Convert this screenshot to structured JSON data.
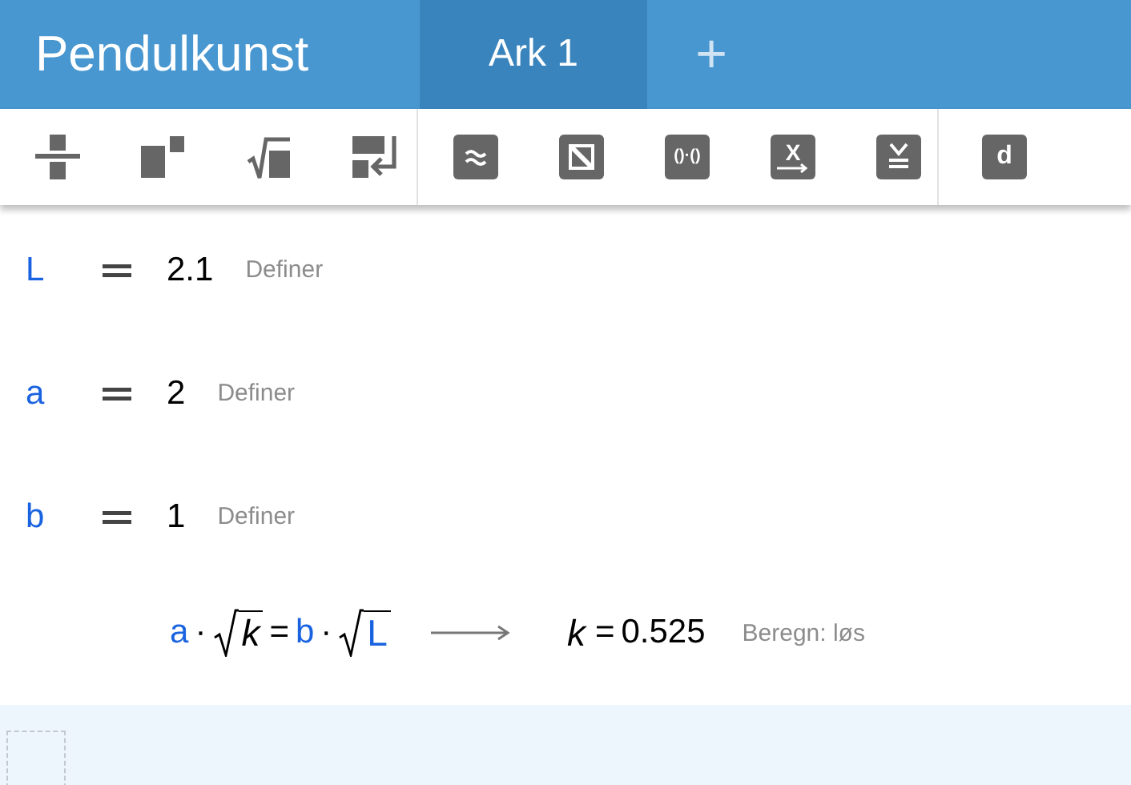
{
  "app": {
    "title": "Pendulkunst"
  },
  "tabs": [
    {
      "label": "Ark 1",
      "selected": true
    }
  ],
  "add_tab": {
    "label": "+"
  },
  "toolbar": {
    "groups": [
      [
        {
          "kind": "fraction"
        },
        {
          "kind": "power"
        },
        {
          "kind": "root"
        },
        {
          "kind": "newline"
        }
      ],
      [
        {
          "kind": "approx-badge"
        },
        {
          "kind": "slash-badge"
        },
        {
          "kind": "text-badge",
          "glyph": "()·()"
        },
        {
          "kind": "arrow-badge",
          "glyph": "X"
        },
        {
          "kind": "check-badge"
        }
      ],
      [
        {
          "kind": "text-badge",
          "glyph": "d"
        }
      ]
    ]
  },
  "definitions": [
    {
      "name": "L",
      "value": "2.1",
      "action": "Definer"
    },
    {
      "name": "a",
      "value": "2",
      "action": "Definer"
    },
    {
      "name": "b",
      "value": "1",
      "action": "Definer"
    }
  ],
  "equation": {
    "lhs": [
      {
        "kind": "var",
        "text": "a"
      },
      {
        "kind": "op",
        "text": "·"
      },
      {
        "kind": "sqrt",
        "text": "k",
        "known": false
      },
      {
        "kind": "op",
        "text": "="
      },
      {
        "kind": "var",
        "text": "b"
      },
      {
        "kind": "op",
        "text": "·"
      },
      {
        "kind": "sqrt",
        "text": "L",
        "known": true
      }
    ],
    "result_var": "k",
    "result_op": "=",
    "result_value": "0.525",
    "action": "Beregn: løs"
  }
}
